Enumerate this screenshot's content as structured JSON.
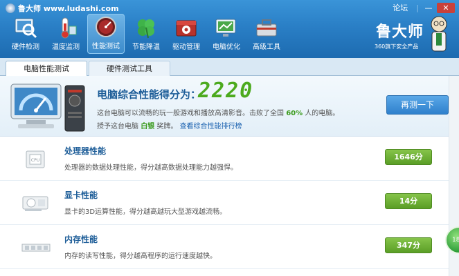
{
  "window": {
    "title": "鲁大师 www.ludashi.com",
    "forum": "论坛",
    "minimize": "—",
    "close": "✕"
  },
  "toolbar": [
    {
      "label": "硬件检测",
      "icon": "magnifier-icon",
      "active": false
    },
    {
      "label": "温度监测",
      "icon": "thermometer-icon",
      "active": false
    },
    {
      "label": "性能测试",
      "icon": "speedometer-icon",
      "active": true
    },
    {
      "label": "节能降温",
      "icon": "clover-icon",
      "active": false
    },
    {
      "label": "驱动管理",
      "icon": "gear-box-icon",
      "active": false
    },
    {
      "label": "电脑优化",
      "icon": "monitor-icon",
      "active": false
    },
    {
      "label": "高级工具",
      "icon": "toolbox-icon",
      "active": false
    }
  ],
  "brand": {
    "title": "鲁大师",
    "subtitle": "360旗下安全产品"
  },
  "tabs": [
    {
      "label": "电脑性能测试",
      "active": true
    },
    {
      "label": "硬件测试工具",
      "active": false
    }
  ],
  "summary": {
    "title": "电脑综合性能得分为：",
    "score": "2220",
    "desc_prefix": "这台电脑可以流畅的玩一般游戏和播放高清影音。击败了全国",
    "percent": "60%",
    "desc_suffix": "人的电脑。",
    "award_prefix": "授予这台电脑",
    "award_value": "白银",
    "award_suffix": "奖牌。",
    "rank_link": "查看综合性能排行榜",
    "retest_label": "再测一下"
  },
  "items": [
    {
      "title": "处理器性能",
      "desc": "处理器的数据处理性能，得分越高数据处理能力越强悍。",
      "score": "1646分",
      "icon": "cpu-icon"
    },
    {
      "title": "显卡性能",
      "desc": "显卡的3D运算性能，得分越高越玩大型游戏越流畅。",
      "score": "14分",
      "icon": "graphics-card-icon"
    },
    {
      "title": "内存性能",
      "desc": "内存的读写性能，得分越高程序的运行速度越快。",
      "score": "347分",
      "icon": "memory-icon"
    }
  ],
  "float_ball": "18",
  "colors": {
    "banner": "#2a7fc6",
    "score_green": "#4caa1e",
    "title_blue": "#1d5d98",
    "button_green": "#5a9e26"
  }
}
